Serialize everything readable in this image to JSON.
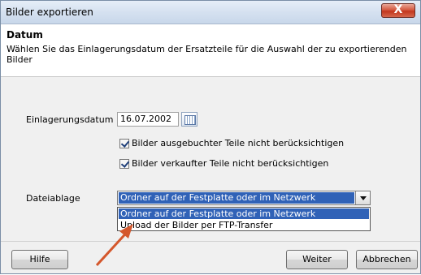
{
  "window": {
    "title": "Bilder exportieren",
    "close_glyph": "X"
  },
  "header": {
    "title": "Datum",
    "description": "Wählen Sie das Einlagerungsdatum der Ersatzteile für die Auswahl der zu exportierenden Bilder"
  },
  "form": {
    "date_label": "Einlagerungsdatum",
    "date_value": "16.07.2002",
    "checkbox_1": {
      "label": "Bilder ausgebuchter Teile nicht berücksichtigen",
      "checked": true
    },
    "checkbox_2": {
      "label": "Bilder verkaufter Teile nicht berücksichtigen",
      "checked": true
    },
    "storage_label": "Dateiablage",
    "storage_selected": "Ordner auf der Festplatte oder im Netzwerk",
    "storage_options": [
      "Ordner auf der Festplatte oder im Netzwerk",
      "Upload der Bilder per FTP-Transfer"
    ]
  },
  "buttons": {
    "help": "Hilfe",
    "next": "Weiter",
    "cancel": "Abbrechen"
  },
  "annotation": {
    "arrow_color": "#d4572c"
  }
}
